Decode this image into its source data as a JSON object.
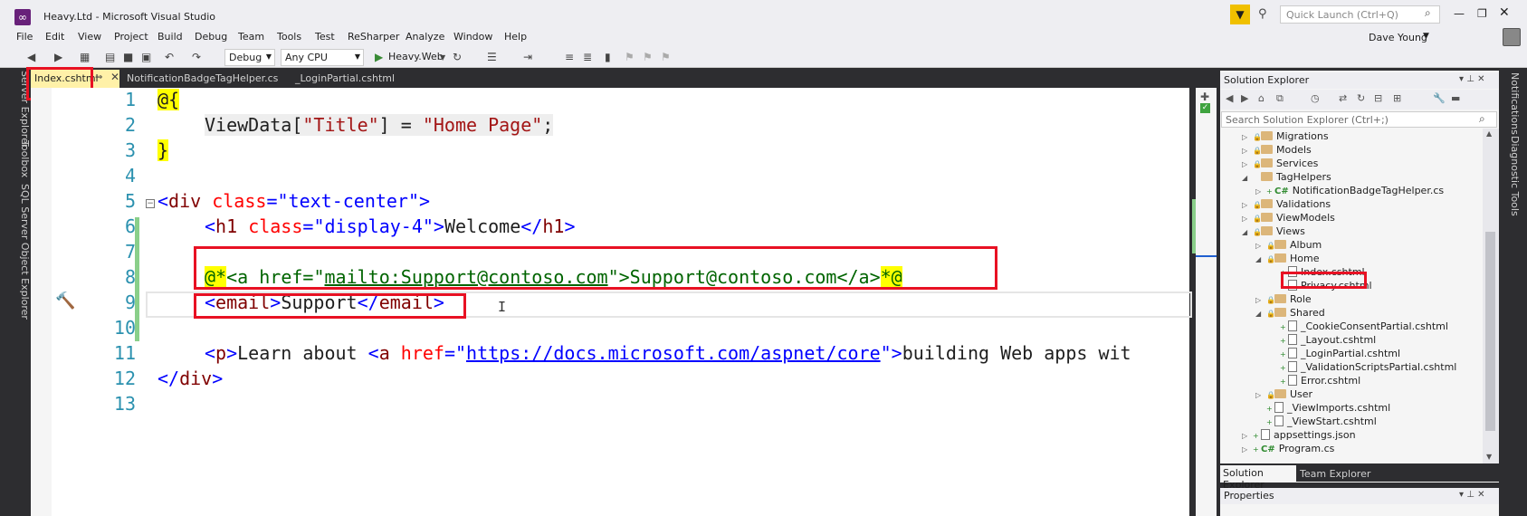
{
  "window": {
    "title": "Heavy.Ltd - Microsoft Visual Studio",
    "quick_launch_placeholder": "Quick Launch (Ctrl+Q)"
  },
  "menu": [
    "File",
    "Edit",
    "View",
    "Project",
    "Build",
    "Debug",
    "Team",
    "Tools",
    "Test",
    "ReSharper",
    "Analyze",
    "Window",
    "Help"
  ],
  "user": {
    "name": "Dave Young"
  },
  "toolbar": {
    "config": "Debug",
    "platform": "Any CPU",
    "run_target": "Heavy.Web"
  },
  "left_tool_windows": [
    "Server Explorer",
    "Toolbox",
    "SQL Server Object Explorer"
  ],
  "right_tool_windows": [
    "Notifications",
    "Diagnostic Tools"
  ],
  "tabs": {
    "active": "Index.cshtml",
    "others": [
      "NotificationBadgeTagHelper.cs",
      "_LoginPartial.cshtml"
    ]
  },
  "editor": {
    "line_numbers": [
      "1",
      "2",
      "3",
      "4",
      "5",
      "6",
      "7",
      "8",
      "9",
      "10",
      "11",
      "12",
      "13"
    ],
    "l1_razor": "@{",
    "l2": {
      "a": "ViewData[",
      "b": "\"Title\"",
      "c": "] = ",
      "d": "\"Home Page\"",
      "e": ";"
    },
    "l3": "}",
    "l5": {
      "a": "<",
      "b": "div",
      "c": "class",
      "d": "=",
      "e": "\"text-center\"",
      "f": ">"
    },
    "l6": {
      "a": "<",
      "b": "h1",
      "c": "class",
      "d": "=",
      "e": "\"display-4\"",
      "f": ">",
      "g": "Welcome",
      "h": "</",
      "i": "h1",
      "j": ">"
    },
    "l8": {
      "a": "@*",
      "b": "<",
      "c": "a",
      "d": "href",
      "e": "=\"",
      "f": "mailto:Support@contoso.com",
      "g": "\"",
      "h": ">",
      "i": "Support@contoso.com",
      "j": "</",
      "k": "a",
      "l": ">",
      "m": "*@"
    },
    "l9": {
      "a": "<",
      "b": "email",
      "c": ">",
      "d": "Support",
      "e": "</",
      "f": "email",
      "g": ">"
    },
    "l11": {
      "a": "<",
      "b": "p",
      "c": ">",
      "d": "Learn about ",
      "e": "<",
      "f": "a",
      "g": "href",
      "h": "=\"",
      "i": "https://docs.microsoft.com/aspnet/core",
      "j": "\"",
      "k": ">",
      "l": "building Web apps wit"
    },
    "l12": {
      "a": "</",
      "b": "div",
      "c": ">"
    }
  },
  "solution_explorer": {
    "title": "Solution Explorer",
    "search_placeholder": "Search Solution Explorer (Ctrl+;)",
    "items": [
      "Migrations",
      "Models",
      "Services",
      "TagHelpers",
      "NotificationBadgeTagHelper.cs",
      "Validations",
      "ViewModels",
      "Views",
      "Album",
      "Home",
      "Index.cshtml",
      "Privacy.cshtml",
      "Role",
      "Shared",
      "_CookieConsentPartial.cshtml",
      "_Layout.cshtml",
      "_LoginPartial.cshtml",
      "_ValidationScriptsPartial.cshtml",
      "Error.cshtml",
      "User",
      "_ViewImports.cshtml",
      "_ViewStart.cshtml",
      "appsettings.json",
      "Program.cs"
    ],
    "tabs": [
      "Solution Explorer",
      "Team Explorer"
    ]
  },
  "properties": {
    "title": "Properties"
  }
}
